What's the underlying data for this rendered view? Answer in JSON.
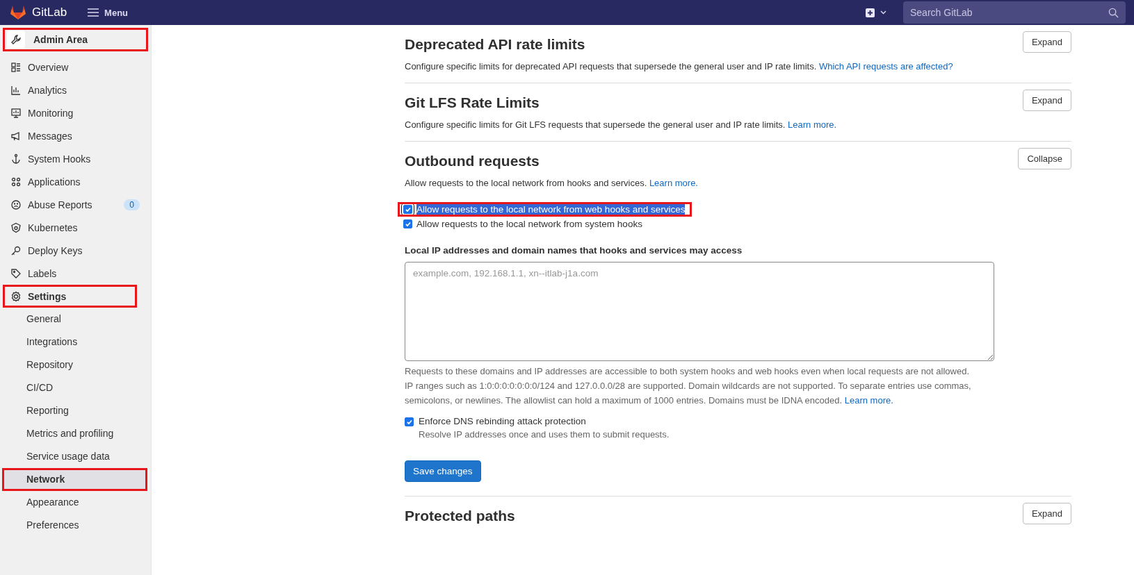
{
  "header": {
    "logo_text": "GitLab",
    "menu_label": "Menu",
    "search_placeholder": "Search GitLab"
  },
  "sidebar": {
    "title": {
      "label": "Admin Area",
      "highlighted": true
    },
    "items": [
      {
        "label": "Overview",
        "highlighted": false
      },
      {
        "label": "Analytics",
        "highlighted": false
      },
      {
        "label": "Monitoring",
        "highlighted": false
      },
      {
        "label": "Messages",
        "highlighted": false
      },
      {
        "label": "System Hooks",
        "highlighted": false
      },
      {
        "label": "Applications",
        "highlighted": false
      },
      {
        "label": "Abuse Reports",
        "badge": "0",
        "highlighted": false
      },
      {
        "label": "Kubernetes",
        "highlighted": false
      },
      {
        "label": "Deploy Keys",
        "highlighted": false
      },
      {
        "label": "Labels",
        "highlighted": false
      },
      {
        "label": "Settings",
        "highlighted": true,
        "children": [
          {
            "label": "General",
            "selected": false,
            "highlighted": false
          },
          {
            "label": "Integrations",
            "selected": false,
            "highlighted": false
          },
          {
            "label": "Repository",
            "selected": false,
            "highlighted": false
          },
          {
            "label": "CI/CD",
            "selected": false,
            "highlighted": false
          },
          {
            "label": "Reporting",
            "selected": false,
            "highlighted": false
          },
          {
            "label": "Metrics and profiling",
            "selected": false,
            "highlighted": false
          },
          {
            "label": "Service usage data",
            "selected": false,
            "highlighted": false
          },
          {
            "label": "Network",
            "selected": true,
            "highlighted": true
          },
          {
            "label": "Appearance",
            "selected": false,
            "highlighted": false
          },
          {
            "label": "Preferences",
            "selected": false,
            "highlighted": false
          }
        ]
      }
    ]
  },
  "sections": [
    {
      "title": "Deprecated API rate limits",
      "description": "Configure specific limits for deprecated API requests that supersede the general user and IP rate limits.",
      "link": "Which API requests are affected?",
      "button": "Expand"
    },
    {
      "title": "Git LFS Rate Limits",
      "description": "Configure specific limits for Git LFS requests that supersede the general user and IP rate limits.",
      "link": "Learn more.",
      "button": "Expand"
    },
    {
      "title": "Outbound requests",
      "description": "Allow requests to the local network from hooks and services.",
      "link": "Learn more.",
      "button": "Collapse",
      "checkboxes": [
        {
          "label": "Allow requests to the local network from web hooks and services",
          "checked": true,
          "text_selected": true,
          "highlighted": true
        },
        {
          "label": "Allow requests to the local network from system hooks",
          "checked": true,
          "text_selected": false,
          "highlighted": false
        }
      ],
      "allowlist": {
        "label": "Local IP addresses and domain names that hooks and services may access",
        "placeholder": "example.com, 192.168.1.1, xn--itlab-j1a.com",
        "help": "Requests to these domains and IP addresses are accessible to both system hooks and web hooks even when local requests are not allowed. IP ranges such as 1:0:0:0:0:0:0:0/124 and 127.0.0.0/28 are supported. Domain wildcards are not supported. To separate entries use commas, semicolons, or newlines. The allowlist can hold a maximum of 1000 entries. Domains must be IDNA encoded.",
        "help_link": "Learn more."
      },
      "dns": {
        "label": "Enforce DNS rebinding attack protection",
        "checked": true,
        "help": "Resolve IP addresses once and uses them to submit requests."
      },
      "save": "Save changes"
    },
    {
      "title": "Protected paths",
      "button": "Expand"
    }
  ]
}
